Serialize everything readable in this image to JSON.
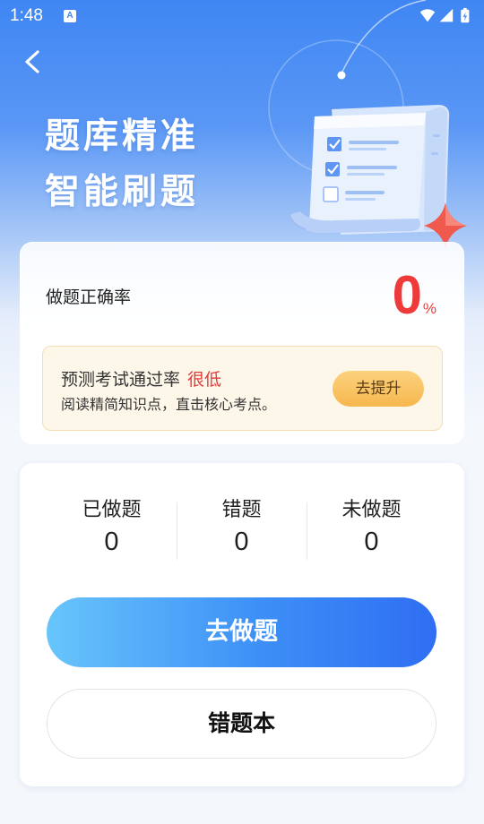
{
  "status_bar": {
    "time": "1:48",
    "notification_icon": "A",
    "icons": [
      "wifi-icon",
      "signal-icon",
      "battery-charging-icon"
    ]
  },
  "header": {
    "back_icon": "chevron-left-icon",
    "title_line1": "题库精准",
    "title_line2": "智能刷题"
  },
  "accuracy_card": {
    "label": "做题正确率",
    "value": "0",
    "unit": "%",
    "prediction": {
      "text": "预测考试通过率",
      "level": "很低",
      "subtitle": "阅读精简知识点，直击核心考点。",
      "button_label": "去提升"
    }
  },
  "stats_card": {
    "stats": [
      {
        "label": "已做题",
        "value": "0"
      },
      {
        "label": "错题",
        "value": "0"
      },
      {
        "label": "未做题",
        "value": "0"
      }
    ],
    "primary_button": "去做题",
    "secondary_button": "错题本"
  },
  "colors": {
    "brand_blue": "#3f86f3",
    "accent_red": "#ef3a3a",
    "improve_button": "#f6b74e"
  }
}
